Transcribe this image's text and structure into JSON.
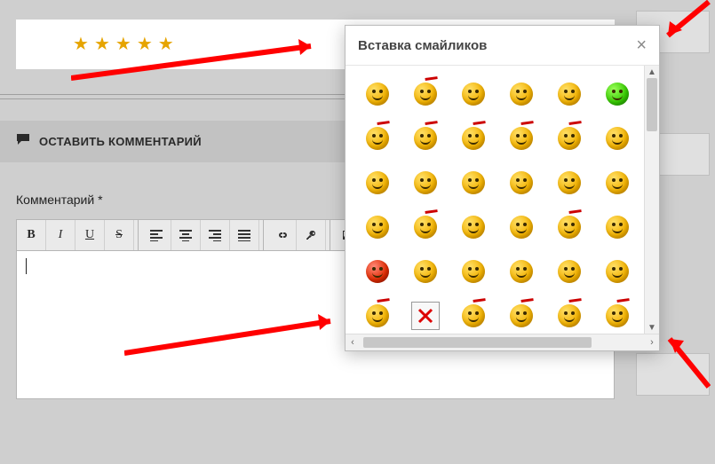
{
  "rating": {
    "stars": 5
  },
  "comment_bar": {
    "icon": "comment-icon",
    "label": "ОСТАВИТЬ КОММЕНТАРИЙ"
  },
  "form": {
    "comment_label": "Комментарий",
    "required_mark": "*"
  },
  "toolbar": {
    "bold": "B",
    "italic": "I",
    "underline": "U",
    "strike": "S"
  },
  "popup": {
    "title": "Вставка смайликов",
    "close": "×",
    "smileys": [
      {
        "name": "smile",
        "variant": ""
      },
      {
        "name": "angry",
        "variant": "hair"
      },
      {
        "name": "laugh",
        "variant": ""
      },
      {
        "name": "thumbs",
        "variant": ""
      },
      {
        "name": "kiss",
        "variant": ""
      },
      {
        "name": "green",
        "variant": "green"
      },
      {
        "name": "dizzy",
        "variant": "hair"
      },
      {
        "name": "hair2",
        "variant": "hair"
      },
      {
        "name": "tongue",
        "variant": "hair"
      },
      {
        "name": "hair3",
        "variant": "hair"
      },
      {
        "name": "hair4",
        "variant": "hair"
      },
      {
        "name": "side",
        "variant": ""
      },
      {
        "name": "big",
        "variant": ""
      },
      {
        "name": "grin",
        "variant": ""
      },
      {
        "name": "flag",
        "variant": ""
      },
      {
        "name": "cool",
        "variant": ""
      },
      {
        "name": "sad",
        "variant": ""
      },
      {
        "name": "mad",
        "variant": ""
      },
      {
        "name": "surprise",
        "variant": ""
      },
      {
        "name": "hair5",
        "variant": "hair"
      },
      {
        "name": "point",
        "variant": ""
      },
      {
        "name": "wave",
        "variant": ""
      },
      {
        "name": "hair6",
        "variant": "hair"
      },
      {
        "name": "sleep",
        "variant": ""
      },
      {
        "name": "devil",
        "variant": "red"
      },
      {
        "name": "pair",
        "variant": ""
      },
      {
        "name": "happy",
        "variant": ""
      },
      {
        "name": "ghost",
        "variant": ""
      },
      {
        "name": "twin",
        "variant": ""
      },
      {
        "name": "fly",
        "variant": ""
      },
      {
        "name": "hair7",
        "variant": "hair"
      },
      {
        "name": "cross",
        "variant": "cross"
      },
      {
        "name": "hair8",
        "variant": "hair"
      },
      {
        "name": "hair9",
        "variant": "hair"
      },
      {
        "name": "hair10",
        "variant": "hair"
      },
      {
        "name": "hair11",
        "variant": "hair"
      },
      {
        "name": "row7a",
        "variant": ""
      },
      {
        "name": "row7b",
        "variant": ""
      },
      {
        "name": "row7c",
        "variant": ""
      },
      {
        "name": "row7d",
        "variant": ""
      },
      {
        "name": "row7e",
        "variant": ""
      },
      {
        "name": "row7f",
        "variant": ""
      }
    ]
  }
}
